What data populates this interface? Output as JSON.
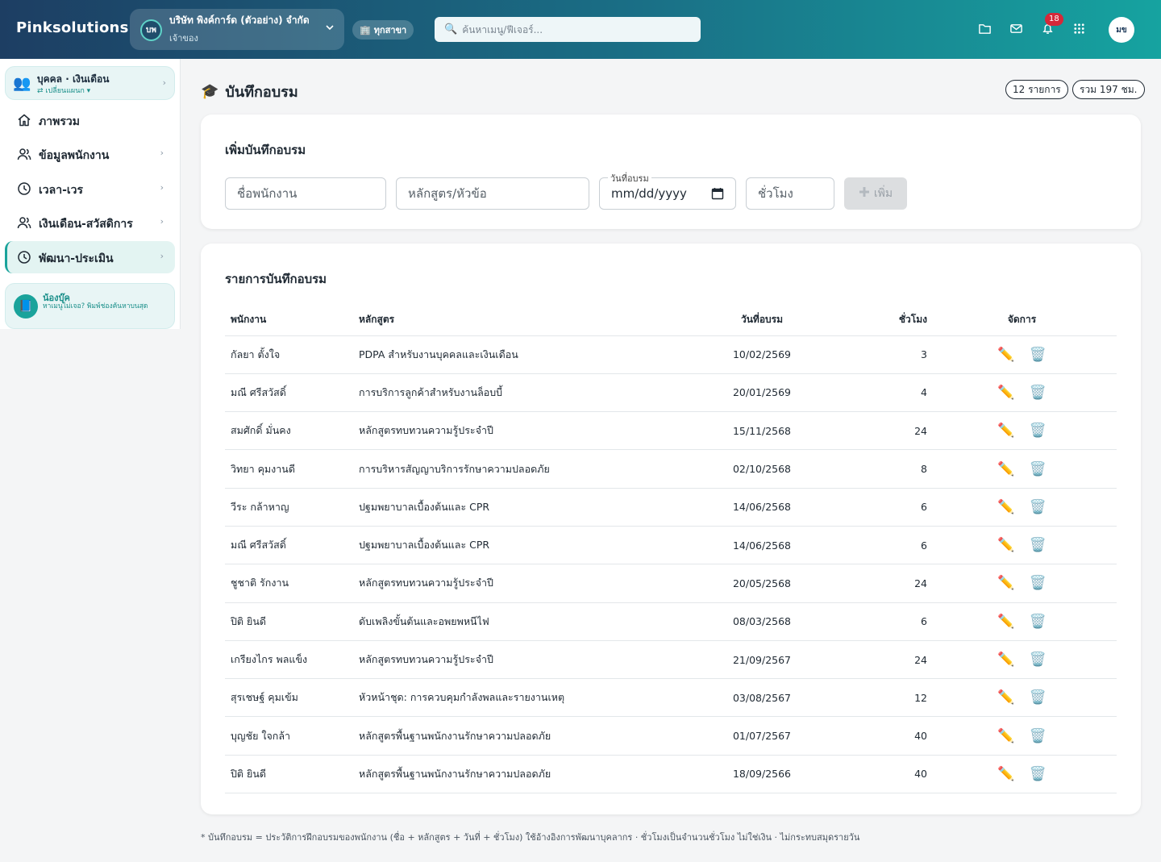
{
  "header": {
    "brand": "Pinksolutions",
    "company_badge": "บพ",
    "company_name": "บริษัท พิงค์การ์ด (ตัวอย่าง) จำกัด",
    "company_role": "เจ้าของ",
    "branch_label": "ทุกสาขา",
    "search_placeholder": "ค้นหาเมนู/ฟีเจอร์...",
    "notification_count": "18",
    "avatar_initials": "มข"
  },
  "sidebar": {
    "module_title": "บุคคล · เงินเดือน",
    "module_switch": "⇄ เปลี่ยนแผนก ▾",
    "items": [
      {
        "label": "ภาพรวม",
        "icon": "home-icon",
        "chevron": false
      },
      {
        "label": "ข้อมูลพนักงาน",
        "icon": "users-icon",
        "chevron": true
      },
      {
        "label": "เวลา-เวร",
        "icon": "clock-icon",
        "chevron": true
      },
      {
        "label": "เงินเดือน-สวัสดิการ",
        "icon": "users-icon",
        "chevron": true
      },
      {
        "label": "พัฒนา-ประเมิน",
        "icon": "clock-icon",
        "chevron": true,
        "active": true
      }
    ],
    "helper_title": "น้องบุ๊ค",
    "helper_text": "หาเมนูไม่เจอ? พิมพ์ช่องค้นหาบนสุด"
  },
  "page": {
    "title": "บันทึกอบรม",
    "count_pill": "12 รายการ",
    "total_pill": "รวม 197 ชม."
  },
  "form": {
    "title": "เพิ่มบันทึกอบรม",
    "employee_placeholder": "ชื่อพนักงาน",
    "course_placeholder": "หลักสูตร/หัวข้อ",
    "date_label": "วันที่อบรม",
    "date_placeholder": "mm/dd/yyyy",
    "hours_placeholder": "ชั่วโมง",
    "add_label": "เพิ่ม"
  },
  "list": {
    "title": "รายการบันทึกอบรม",
    "columns": {
      "employee": "พนักงาน",
      "course": "หลักสูตร",
      "date": "วันที่อบรม",
      "hours": "ชั่วโมง",
      "actions": "จัดการ"
    },
    "rows": [
      {
        "employee": "กัลยา ตั้งใจ",
        "course": "PDPA สำหรับงานบุคคลและเงินเดือน",
        "date": "10/02/2569",
        "hours": "3"
      },
      {
        "employee": "มณี ศรีสวัสดิ์",
        "course": "การบริการลูกค้าสำหรับงานล็อบบี้",
        "date": "20/01/2569",
        "hours": "4"
      },
      {
        "employee": "สมศักดิ์ มั่นคง",
        "course": "หลักสูตรทบทวนความรู้ประจำปี",
        "date": "15/11/2568",
        "hours": "24"
      },
      {
        "employee": "วิทยา คุมงานดี",
        "course": "การบริหารสัญญาบริการรักษาความปลอดภัย",
        "date": "02/10/2568",
        "hours": "8"
      },
      {
        "employee": "วีระ กล้าหาญ",
        "course": "ปฐมพยาบาลเบื้องต้นและ CPR",
        "date": "14/06/2568",
        "hours": "6"
      },
      {
        "employee": "มณี ศรีสวัสดิ์",
        "course": "ปฐมพยาบาลเบื้องต้นและ CPR",
        "date": "14/06/2568",
        "hours": "6"
      },
      {
        "employee": "ชูชาติ รักงาน",
        "course": "หลักสูตรทบทวนความรู้ประจำปี",
        "date": "20/05/2568",
        "hours": "24"
      },
      {
        "employee": "ปิติ ยินดี",
        "course": "ดับเพลิงขั้นต้นและอพยพหนีไฟ",
        "date": "08/03/2568",
        "hours": "6"
      },
      {
        "employee": "เกรียงไกร พลแข็ง",
        "course": "หลักสูตรทบทวนความรู้ประจำปี",
        "date": "21/09/2567",
        "hours": "24"
      },
      {
        "employee": "สุรเชษฐ์ คุมเข้ม",
        "course": "หัวหน้าชุด: การควบคุมกำลังพลและรายงานเหตุ",
        "date": "03/08/2567",
        "hours": "12"
      },
      {
        "employee": "บุญชัย ใจกล้า",
        "course": "หลักสูตรพื้นฐานพนักงานรักษาความปลอดภัย",
        "date": "01/07/2567",
        "hours": "40"
      },
      {
        "employee": "ปิติ ยินดี",
        "course": "หลักสูตรพื้นฐานพนักงานรักษาความปลอดภัย",
        "date": "18/09/2566",
        "hours": "40"
      }
    ]
  },
  "footnote": "* บันทึกอบรม = ประวัติการฝึกอบรมของพนักงาน (ชื่อ + หลักสูตร + วันที่ + ชั่วโมง) ใช้อ้างอิงการพัฒนาบุคลากร · ชั่วโมงเป็นจำนวนชั่วโมง ไม่ใช่เงิน · ไม่กระทบสมุดรายวัน"
}
